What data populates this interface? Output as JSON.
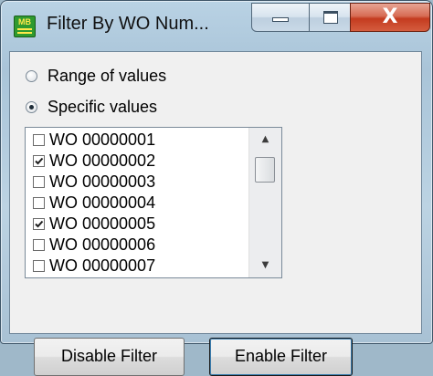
{
  "window": {
    "title": "Filter By WO Num...",
    "icon": "mb-app-icon",
    "icon_text": "MB"
  },
  "caption_buttons": {
    "minimize_icon": "minimize-icon",
    "maximize_icon": "maximize-icon",
    "close_icon": "close-icon",
    "close_glyph": "X"
  },
  "mode": {
    "options": [
      {
        "label": "Range of values",
        "selected": false
      },
      {
        "label": "Specific values",
        "selected": true
      }
    ]
  },
  "values_list": {
    "items": [
      {
        "label": "WO 00000001",
        "checked": false
      },
      {
        "label": "WO 00000002",
        "checked": true
      },
      {
        "label": "WO 00000003",
        "checked": false
      },
      {
        "label": "WO 00000004",
        "checked": false
      },
      {
        "label": "WO 00000005",
        "checked": true
      },
      {
        "label": "WO 00000006",
        "checked": false
      },
      {
        "label": "WO 00000007",
        "checked": false
      }
    ],
    "scroll_up_glyph": "▲",
    "scroll_down_glyph": "▼"
  },
  "buttons": {
    "disable_label": "Disable Filter",
    "enable_label": "Enable Filter"
  },
  "colors": {
    "title_bar": "#b9d2e4",
    "close_button": "#c43b1f",
    "client_bg": "#f0f0f0",
    "app_icon": "#2f9a2f"
  }
}
